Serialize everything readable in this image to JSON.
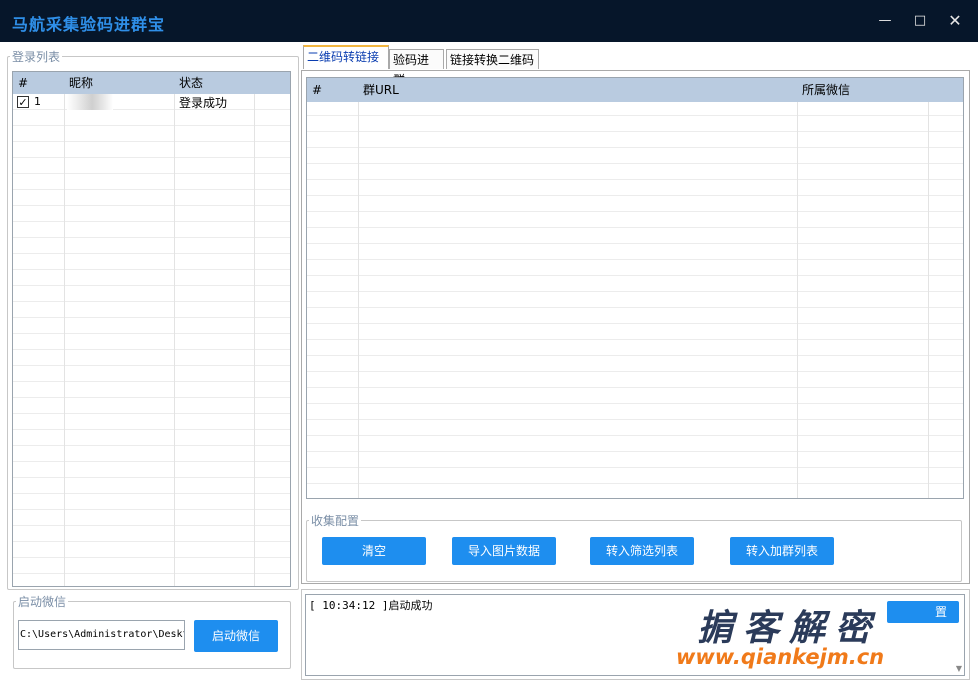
{
  "window": {
    "title": "马航采集验码进群宝"
  },
  "login_list": {
    "legend": "登录列表",
    "columns": [
      "#",
      "昵称",
      "状态"
    ],
    "rows": [
      {
        "index": "1",
        "checked": true,
        "nickname": "",
        "status": "登录成功"
      }
    ]
  },
  "launch": {
    "legend": "启动微信",
    "path_value": "C:\\Users\\Administrator\\Deskt",
    "button": "启动微信"
  },
  "tabs": [
    "二维码转链接",
    "验码进群",
    "链接转换二维码"
  ],
  "url_table": {
    "columns": [
      "#",
      "群URL",
      "所属微信"
    ]
  },
  "collect": {
    "legend": "收集配置",
    "buttons": [
      "清空",
      "导入图片数据",
      "转入筛选列表",
      "转入加群列表"
    ]
  },
  "log": {
    "line": "[ 10:34:12 ]启动成功",
    "button_partial": "置"
  },
  "watermark": {
    "line1": "掮客解密",
    "line2": "www.qiankejm.cn"
  }
}
